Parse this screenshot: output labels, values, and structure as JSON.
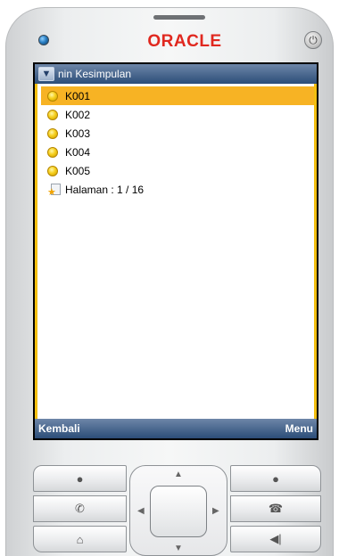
{
  "device": {
    "brand": "ORACLE",
    "power_icon": "power-icon"
  },
  "screen": {
    "title": "nin Kesimpulan",
    "title_icon": "chevron-down-icon",
    "items": [
      {
        "label": "K001",
        "selected": true,
        "icon": "yellow-circle-icon"
      },
      {
        "label": "K002",
        "selected": false,
        "icon": "yellow-circle-icon"
      },
      {
        "label": "K003",
        "selected": false,
        "icon": "yellow-circle-icon"
      },
      {
        "label": "K004",
        "selected": false,
        "icon": "yellow-circle-icon"
      },
      {
        "label": "K005",
        "selected": false,
        "icon": "yellow-circle-icon"
      }
    ],
    "pager": {
      "label": "Halaman : 1 / 16",
      "icon": "page-star-icon"
    },
    "softkeys": {
      "left": "Kembali",
      "right": "Menu"
    }
  },
  "colors": {
    "title_bar": "#2c4d78",
    "selection": "#f7b324",
    "border_accent": "#f3bf10",
    "brand": "#e0281f"
  }
}
